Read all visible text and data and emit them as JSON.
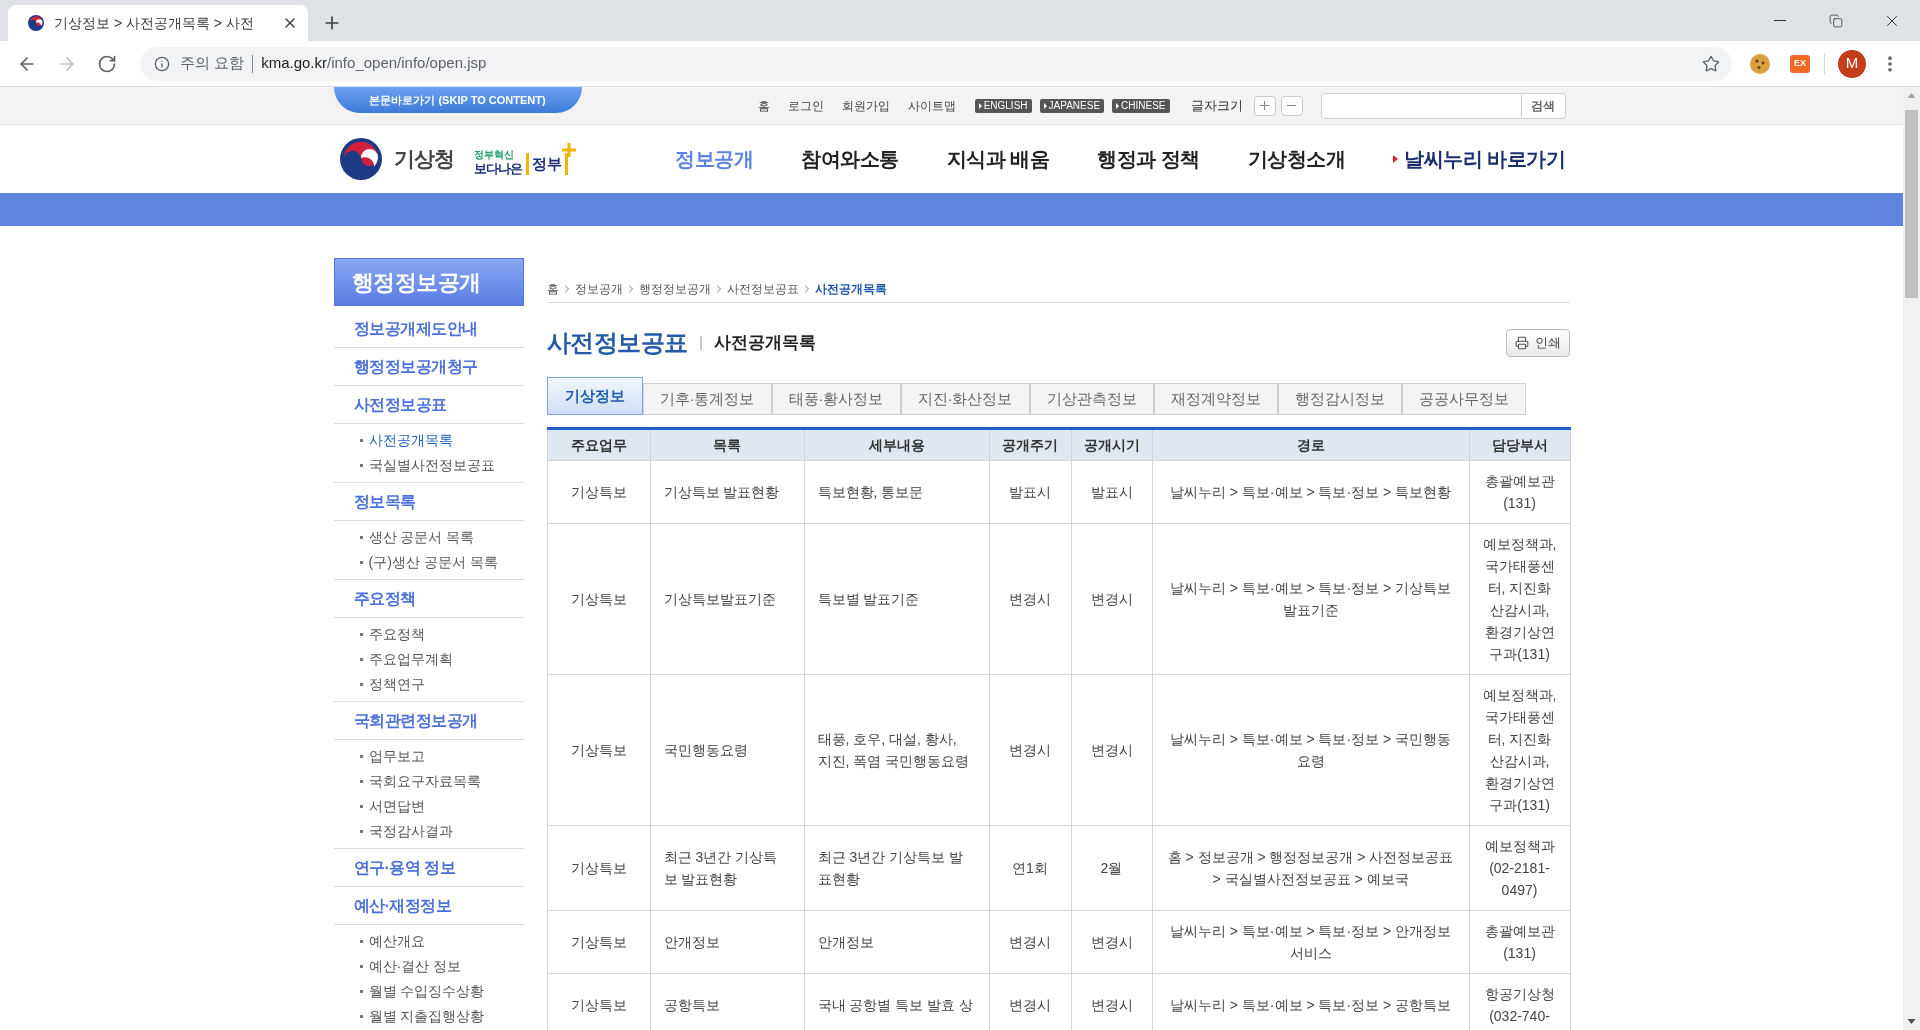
{
  "browser": {
    "tab_title": "기상정보 > 사전공개목록 > 사전",
    "nav": [
      {
        "kind": "back",
        "disabled": false
      },
      {
        "kind": "forward",
        "disabled": true
      },
      {
        "kind": "reload",
        "disabled": false
      }
    ],
    "security_label": "주의 요함",
    "url_host": "kma.go.kr",
    "url_path": "/info_open/info/open.jsp",
    "extension_badge": "EX",
    "avatar": "M"
  },
  "utility_bar": {
    "skip_link": "본문바로가기 (SKIP TO CONTENT)",
    "links": [
      "홈",
      "로그인",
      "회원가입",
      "사이트맵"
    ],
    "languages": [
      "ENGLISH",
      "JAPANESE",
      "CHINESE"
    ],
    "font_size_label": "글자크기",
    "search_button": "검색"
  },
  "header": {
    "logo_text": "기상청",
    "slogan_caption": "정부혁신",
    "slogan_main": "보다나은",
    "slogan_accent": "정부",
    "nav": [
      {
        "label": "정보공개",
        "kind": "menu",
        "selected": true
      },
      {
        "label": "참여와소통",
        "kind": "menu",
        "selected": false
      },
      {
        "label": "지식과 배움",
        "kind": "menu",
        "selected": false
      },
      {
        "label": "행정과 정책",
        "kind": "menu",
        "selected": false
      },
      {
        "label": "기상청소개",
        "kind": "menu",
        "selected": false
      },
      {
        "label": "날씨누리 바로가기",
        "kind": "shortcut",
        "selected": false
      }
    ]
  },
  "sidebar": {
    "title": "행정정보공개",
    "items": [
      {
        "label": "정보공개제도안내"
      },
      {
        "label": "행정정보공개청구"
      },
      {
        "label": "사전정보공표",
        "children": [
          {
            "label": "사전공개목록",
            "selected": true
          },
          {
            "label": "국실별사전정보공표",
            "selected": false
          }
        ]
      },
      {
        "label": "정보목록",
        "children": [
          {
            "label": "생산 공문서 목록",
            "selected": false
          },
          {
            "label": "(구)생산 공문서 목록",
            "selected": false
          }
        ]
      },
      {
        "label": "주요정책",
        "children": [
          {
            "label": "주요정책",
            "selected": false
          },
          {
            "label": "주요업무계획",
            "selected": false
          },
          {
            "label": "정책연구",
            "selected": false
          }
        ]
      },
      {
        "label": "국회관련정보공개",
        "children": [
          {
            "label": "업무보고",
            "selected": false
          },
          {
            "label": "국회요구자료목록",
            "selected": false
          },
          {
            "label": "서면답변",
            "selected": false
          },
          {
            "label": "국정감사결과",
            "selected": false
          }
        ]
      },
      {
        "label": "연구·용역 정보"
      },
      {
        "label": "예산·재정정보",
        "children": [
          {
            "label": "예산개요",
            "selected": false
          },
          {
            "label": "예산·결산 정보",
            "selected": false
          },
          {
            "label": "월별 수입징수상황",
            "selected": false
          },
          {
            "label": "월별 지출집행상황",
            "selected": false
          }
        ]
      }
    ]
  },
  "breadcrumb": [
    {
      "label": "홈",
      "current": false
    },
    {
      "label": "정보공개",
      "current": false
    },
    {
      "label": "행정정보공개",
      "current": false
    },
    {
      "label": "사전정보공표",
      "current": false
    },
    {
      "label": "사전공개목록",
      "current": true
    }
  ],
  "page_title": "사전정보공표",
  "page_subtitle": "사전공개목록",
  "print_button": "인쇄",
  "tabs": [
    {
      "label": "기상정보",
      "selected": true
    },
    {
      "label": "기후·통계정보",
      "selected": false
    },
    {
      "label": "태풍·황사정보",
      "selected": false
    },
    {
      "label": "지진·화산정보",
      "selected": false
    },
    {
      "label": "기상관측정보",
      "selected": false
    },
    {
      "label": "재정계약정보",
      "selected": false
    },
    {
      "label": "행정감시정보",
      "selected": false
    },
    {
      "label": "공공사무정보",
      "selected": false
    }
  ],
  "table": {
    "columns": [
      "주요업무",
      "목록",
      "세부내용",
      "공개주기",
      "공개시기",
      "경로",
      "담당부서"
    ],
    "rows": [
      [
        "기상특보",
        "기상특보 발표현황",
        "특보현황, 통보문",
        "발표시",
        "발표시",
        "날씨누리 > 특보·예보 > 특보·정보 > 특보현황",
        "총괄예보관(131)"
      ],
      [
        "기상특보",
        "기상특보발표기준",
        "특보별 발표기준",
        "변경시",
        "변경시",
        "날씨누리 > 특보·예보 > 특보·정보 > 기상특보 발표기준",
        "예보정책과, 국가태풍센터, 지진화산감시과, 환경기상연구과(131)"
      ],
      [
        "기상특보",
        "국민행동요령",
        "태풍, 호우, 대설, 황사, 지진, 폭염 국민행동요령",
        "변경시",
        "변경시",
        "날씨누리 > 특보·예보 > 특보·정보 > 국민행동요령",
        "예보정책과, 국가태풍센터, 지진화산감시과, 환경기상연구과(131)"
      ],
      [
        "기상특보",
        "최근 3년간 기상특보 발표현황",
        "최근 3년간 기상특보 발표현황",
        "연1회",
        "2월",
        "홈 > 정보공개 > 행정정보공개 > 사전정보공표 > 국실별사전정보공표 > 예보국",
        "예보정책과(02-2181-0497)"
      ],
      [
        "기상특보",
        "안개정보",
        "안개정보",
        "변경시",
        "변경시",
        "날씨누리 > 특보·예보 > 특보·정보 > 안개정보 서비스",
        "총괄예보관(131)"
      ],
      [
        "기상특보",
        "공항특보",
        "국내 공항별 특보 발효 상",
        "변경시",
        "변경시",
        "날씨누리 > 특보·예보 > 특보·정보 > 공항특보",
        "항공기상청(032-740-"
      ]
    ]
  }
}
